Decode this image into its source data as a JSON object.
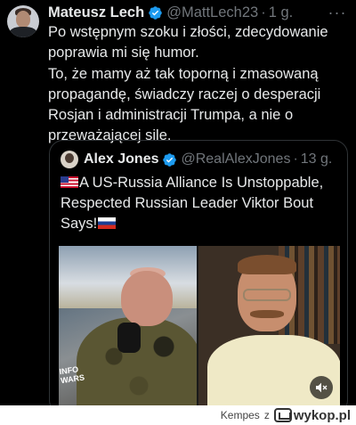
{
  "tweet": {
    "author_name": "Mateusz Lech",
    "author_handle": "@MattLech23",
    "separator": "·",
    "time": "1 g.",
    "more_label": "···",
    "text_line1": "Po wstępnym szoku i złości, zdecydowanie poprawia mi się humor.",
    "text_line2": "To, że mamy aż tak toporną i zmasowaną propagandę, świadczy raczej o desperacji Rosjan i administracji Trumpa, a nie o przeważającej sile."
  },
  "quoted_tweet": {
    "author_name": "Alex Jones",
    "author_handle": "@RealAlexJones",
    "separator": "·",
    "time": "13 g.",
    "text": "A US-Russia Alliance Is Unstoppable, Respected Russian Leader Viktor Bout Says!",
    "leading_emoji": "us-flag",
    "trailing_emoji": "russia-flag",
    "video_overlay_logo": "INFO WARS"
  },
  "footer": {
    "username": "Kempes",
    "connector": "z",
    "site": "wykop.pl"
  },
  "colors": {
    "background": "#000000",
    "primary_text": "#e7e9ea",
    "secondary_text": "#71767b",
    "verified_badge": "#1d9bf0",
    "border": "#2f3336"
  }
}
